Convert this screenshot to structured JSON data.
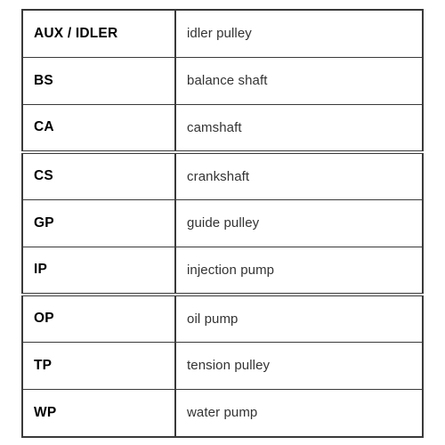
{
  "document": {
    "type": "abbreviation-legend-table",
    "columns": [
      "code",
      "description"
    ],
    "colors": {
      "background": "#ffffff",
      "border": "#3a3a3a",
      "code_text": "#000000",
      "description_text": "#333333"
    },
    "rows": [
      {
        "code": "AUX / IDLER",
        "description": "idler pulley",
        "group_end": false
      },
      {
        "code": "BS",
        "description": "balance shaft",
        "group_end": false
      },
      {
        "code": "CA",
        "description": "camshaft",
        "group_end": true
      },
      {
        "code": "CS",
        "description": "crankshaft",
        "group_end": false
      },
      {
        "code": "GP",
        "description": "guide pulley",
        "group_end": false
      },
      {
        "code": "IP",
        "description": "injection pump",
        "group_end": true
      },
      {
        "code": "OP",
        "description": "oil pump",
        "group_end": false
      },
      {
        "code": "TP",
        "description": "tension pulley",
        "group_end": false
      },
      {
        "code": "WP",
        "description": "water pump",
        "group_end": false
      }
    ]
  }
}
